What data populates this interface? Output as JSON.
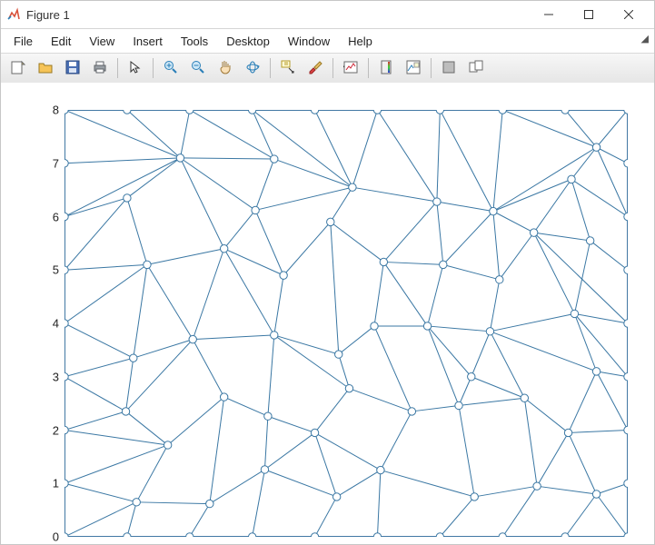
{
  "window": {
    "title": "Figure 1"
  },
  "menus": [
    "File",
    "Edit",
    "View",
    "Insert",
    "Tools",
    "Desktop",
    "Window",
    "Help"
  ],
  "toolbar_icons": [
    {
      "name": "new-figure-icon"
    },
    {
      "name": "open-icon"
    },
    {
      "name": "save-icon"
    },
    {
      "name": "print-icon"
    },
    {
      "sep": true
    },
    {
      "name": "pointer-icon"
    },
    {
      "sep": true
    },
    {
      "name": "zoom-in-icon"
    },
    {
      "name": "zoom-out-icon"
    },
    {
      "name": "pan-icon"
    },
    {
      "name": "rotate3d-icon"
    },
    {
      "sep": true
    },
    {
      "name": "datacursor-icon"
    },
    {
      "name": "brush-icon"
    },
    {
      "sep": true
    },
    {
      "name": "link-icon"
    },
    {
      "sep": true
    },
    {
      "name": "colorbar-icon"
    },
    {
      "name": "legend-icon"
    },
    {
      "sep": true
    },
    {
      "name": "hide-tools-icon"
    },
    {
      "name": "dock-icon"
    }
  ],
  "chart_data": {
    "type": "scatter",
    "mesh_kind": "triangulation",
    "xlim": [
      0,
      9
    ],
    "ylim": [
      0,
      8
    ],
    "yticks": [
      0,
      1,
      2,
      3,
      4,
      5,
      6,
      7,
      8
    ],
    "marker": "circle",
    "color": "#3a77a3",
    "nodes": [
      [
        0,
        0
      ],
      [
        1,
        0
      ],
      [
        2,
        0
      ],
      [
        3,
        0
      ],
      [
        4,
        0
      ],
      [
        5,
        0
      ],
      [
        6,
        0
      ],
      [
        7,
        0
      ],
      [
        8,
        0
      ],
      [
        9,
        0
      ],
      [
        0,
        8
      ],
      [
        1,
        8
      ],
      [
        2,
        8
      ],
      [
        3,
        8
      ],
      [
        4,
        8
      ],
      [
        5,
        8
      ],
      [
        6,
        8
      ],
      [
        7,
        8
      ],
      [
        8,
        8
      ],
      [
        9,
        8
      ],
      [
        0,
        1
      ],
      [
        0,
        2
      ],
      [
        0,
        3
      ],
      [
        0,
        4
      ],
      [
        0,
        5
      ],
      [
        0,
        6
      ],
      [
        0,
        7
      ],
      [
        9,
        1
      ],
      [
        9,
        2
      ],
      [
        9,
        3
      ],
      [
        9,
        4
      ],
      [
        9,
        5
      ],
      [
        9,
        6
      ],
      [
        9,
        7
      ],
      [
        1.15,
        0.65
      ],
      [
        2.32,
        0.62
      ],
      [
        3.2,
        1.26
      ],
      [
        4.35,
        0.75
      ],
      [
        5.05,
        1.25
      ],
      [
        6.55,
        0.75
      ],
      [
        7.55,
        0.95
      ],
      [
        8.5,
        0.8
      ],
      [
        0.98,
        2.35
      ],
      [
        1.65,
        1.72
      ],
      [
        2.55,
        2.62
      ],
      [
        3.25,
        2.26
      ],
      [
        4.0,
        1.95
      ],
      [
        4.55,
        2.78
      ],
      [
        5.55,
        2.35
      ],
      [
        6.3,
        2.46
      ],
      [
        6.5,
        3.0
      ],
      [
        7.35,
        2.6
      ],
      [
        8.05,
        1.95
      ],
      [
        8.5,
        3.1
      ],
      [
        1.1,
        3.35
      ],
      [
        2.05,
        3.7
      ],
      [
        3.35,
        3.78
      ],
      [
        4.38,
        3.42
      ],
      [
        4.95,
        3.95
      ],
      [
        5.8,
        3.95
      ],
      [
        6.8,
        3.85
      ],
      [
        8.15,
        4.18
      ],
      [
        1.32,
        5.1
      ],
      [
        2.55,
        5.4
      ],
      [
        3.5,
        4.9
      ],
      [
        4.25,
        5.9
      ],
      [
        5.1,
        5.15
      ],
      [
        6.05,
        5.1
      ],
      [
        6.95,
        4.82
      ],
      [
        7.5,
        5.7
      ],
      [
        8.4,
        5.55
      ],
      [
        1.0,
        6.35
      ],
      [
        1.85,
        7.1
      ],
      [
        3.05,
        6.12
      ],
      [
        4.6,
        6.55
      ],
      [
        5.95,
        6.28
      ],
      [
        6.85,
        6.1
      ],
      [
        8.1,
        6.7
      ],
      [
        8.5,
        7.3
      ],
      [
        3.35,
        7.08
      ]
    ],
    "edges": [
      [
        0,
        1
      ],
      [
        1,
        2
      ],
      [
        2,
        3
      ],
      [
        3,
        4
      ],
      [
        4,
        5
      ],
      [
        5,
        6
      ],
      [
        6,
        7
      ],
      [
        7,
        8
      ],
      [
        8,
        9
      ],
      [
        0,
        20
      ],
      [
        20,
        21
      ],
      [
        21,
        22
      ],
      [
        22,
        23
      ],
      [
        23,
        24
      ],
      [
        24,
        25
      ],
      [
        25,
        26
      ],
      [
        26,
        10
      ],
      [
        10,
        11
      ],
      [
        11,
        12
      ],
      [
        12,
        13
      ],
      [
        13,
        14
      ],
      [
        14,
        15
      ],
      [
        15,
        16
      ],
      [
        16,
        17
      ],
      [
        17,
        18
      ],
      [
        18,
        19
      ],
      [
        9,
        27
      ],
      [
        27,
        28
      ],
      [
        28,
        29
      ],
      [
        29,
        30
      ],
      [
        30,
        31
      ],
      [
        31,
        32
      ],
      [
        32,
        33
      ],
      [
        33,
        19
      ],
      [
        0,
        34
      ],
      [
        1,
        34
      ],
      [
        20,
        34
      ],
      [
        34,
        35
      ],
      [
        2,
        35
      ],
      [
        35,
        36
      ],
      [
        3,
        36
      ],
      [
        36,
        37
      ],
      [
        4,
        37
      ],
      [
        37,
        38
      ],
      [
        5,
        38
      ],
      [
        38,
        39
      ],
      [
        6,
        39
      ],
      [
        39,
        40
      ],
      [
        7,
        40
      ],
      [
        40,
        41
      ],
      [
        8,
        41
      ],
      [
        9,
        41
      ],
      [
        27,
        41
      ],
      [
        20,
        43
      ],
      [
        21,
        43
      ],
      [
        34,
        43
      ],
      [
        21,
        42
      ],
      [
        42,
        43
      ],
      [
        43,
        44
      ],
      [
        35,
        44
      ],
      [
        36,
        45
      ],
      [
        44,
        45
      ],
      [
        45,
        46
      ],
      [
        36,
        46
      ],
      [
        37,
        46
      ],
      [
        38,
        46
      ],
      [
        46,
        47
      ],
      [
        47,
        48
      ],
      [
        38,
        48
      ],
      [
        48,
        49
      ],
      [
        39,
        49
      ],
      [
        49,
        50
      ],
      [
        49,
        51
      ],
      [
        50,
        51
      ],
      [
        40,
        51
      ],
      [
        40,
        52
      ],
      [
        51,
        52
      ],
      [
        41,
        52
      ],
      [
        28,
        52
      ],
      [
        52,
        53
      ],
      [
        28,
        53
      ],
      [
        29,
        53
      ],
      [
        22,
        42
      ],
      [
        22,
        54
      ],
      [
        42,
        54
      ],
      [
        42,
        55
      ],
      [
        44,
        55
      ],
      [
        54,
        55
      ],
      [
        45,
        56
      ],
      [
        47,
        56
      ],
      [
        55,
        56
      ],
      [
        47,
        57
      ],
      [
        56,
        57
      ],
      [
        57,
        58
      ],
      [
        48,
        58
      ],
      [
        58,
        59
      ],
      [
        49,
        59
      ],
      [
        50,
        59
      ],
      [
        50,
        60
      ],
      [
        59,
        60
      ],
      [
        51,
        60
      ],
      [
        53,
        60
      ],
      [
        53,
        61
      ],
      [
        60,
        61
      ],
      [
        29,
        61
      ],
      [
        30,
        61
      ],
      [
        23,
        54
      ],
      [
        23,
        62
      ],
      [
        24,
        62
      ],
      [
        54,
        62
      ],
      [
        55,
        62
      ],
      [
        62,
        63
      ],
      [
        55,
        63
      ],
      [
        56,
        63
      ],
      [
        56,
        64
      ],
      [
        63,
        64
      ],
      [
        64,
        65
      ],
      [
        57,
        65
      ],
      [
        65,
        66
      ],
      [
        58,
        66
      ],
      [
        59,
        66
      ],
      [
        66,
        67
      ],
      [
        59,
        67
      ],
      [
        67,
        68
      ],
      [
        60,
        68
      ],
      [
        68,
        69
      ],
      [
        61,
        69
      ],
      [
        30,
        69
      ],
      [
        69,
        70
      ],
      [
        31,
        70
      ],
      [
        61,
        70
      ],
      [
        24,
        71
      ],
      [
        62,
        71
      ],
      [
        25,
        71
      ],
      [
        71,
        72
      ],
      [
        25,
        72
      ],
      [
        63,
        72
      ],
      [
        72,
        73
      ],
      [
        63,
        73
      ],
      [
        64,
        73
      ],
      [
        73,
        79
      ],
      [
        65,
        74
      ],
      [
        73,
        74
      ],
      [
        74,
        75
      ],
      [
        66,
        75
      ],
      [
        67,
        75
      ],
      [
        75,
        76
      ],
      [
        67,
        76
      ],
      [
        68,
        76
      ],
      [
        69,
        76
      ],
      [
        76,
        77
      ],
      [
        69,
        77
      ],
      [
        70,
        77
      ],
      [
        32,
        77
      ],
      [
        77,
        78
      ],
      [
        32,
        78
      ],
      [
        26,
        72
      ],
      [
        10,
        72
      ],
      [
        11,
        72
      ],
      [
        12,
        72
      ],
      [
        72,
        79
      ],
      [
        12,
        79
      ],
      [
        13,
        79
      ],
      [
        13,
        74
      ],
      [
        74,
        79
      ],
      [
        14,
        74
      ],
      [
        15,
        74
      ],
      [
        15,
        75
      ],
      [
        16,
        75
      ],
      [
        16,
        76
      ],
      [
        17,
        76
      ],
      [
        17,
        78
      ],
      [
        76,
        78
      ],
      [
        18,
        78
      ],
      [
        33,
        78
      ],
      [
        19,
        78
      ]
    ]
  }
}
